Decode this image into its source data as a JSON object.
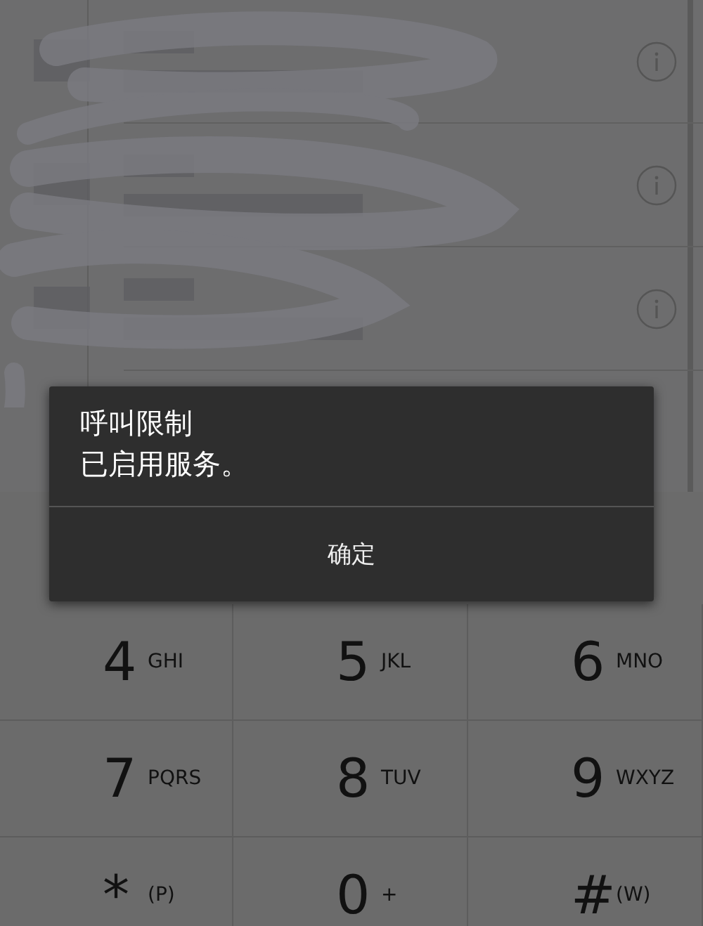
{
  "dialog": {
    "title_lines": [
      "呼叫限制",
      "已启用服务。"
    ],
    "button": "确定"
  },
  "keypad": [
    {
      "digit": "4",
      "letters": "GHI"
    },
    {
      "digit": "5",
      "letters": "JKL"
    },
    {
      "digit": "6",
      "letters": "MNO"
    },
    {
      "digit": "7",
      "letters": "PQRS"
    },
    {
      "digit": "8",
      "letters": "TUV"
    },
    {
      "digit": "9",
      "letters": "WXYZ"
    },
    {
      "digit": "*",
      "letters": "(P)"
    },
    {
      "digit": "0",
      "letters": "+"
    },
    {
      "digit": "#",
      "letters": "(W)"
    }
  ]
}
